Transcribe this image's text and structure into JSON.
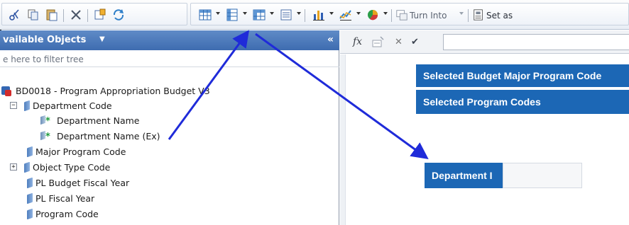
{
  "toolbar": {
    "turn_into_label": "Turn Into",
    "set_as_label": "Set as"
  },
  "left_panel": {
    "title": "vailable Objects",
    "filter_placeholder": "e here to filter tree",
    "tree": {
      "root": "BD0018 - Program Appropriation Budget V3",
      "items": [
        {
          "label": "Department Code",
          "expander": "−"
        },
        {
          "label": "Department Name"
        },
        {
          "label": "Department Name (Ex)"
        },
        {
          "label": "Major Program Code"
        },
        {
          "label": "Object Type Code",
          "expander": "+"
        },
        {
          "label": "PL Budget Fiscal Year"
        },
        {
          "label": "PL Fiscal Year"
        },
        {
          "label": "Program Code"
        }
      ]
    }
  },
  "formula_bar": {
    "fx_label": "fx"
  },
  "report": {
    "filter_rows": [
      "Selected Budget Major Program Code",
      "Selected Program Codes"
    ],
    "table_header": "Department I"
  },
  "colors": {
    "header_blue": "#1c67b5",
    "panel_header": "#4a77ba",
    "arrow": "#1f2bd9"
  }
}
